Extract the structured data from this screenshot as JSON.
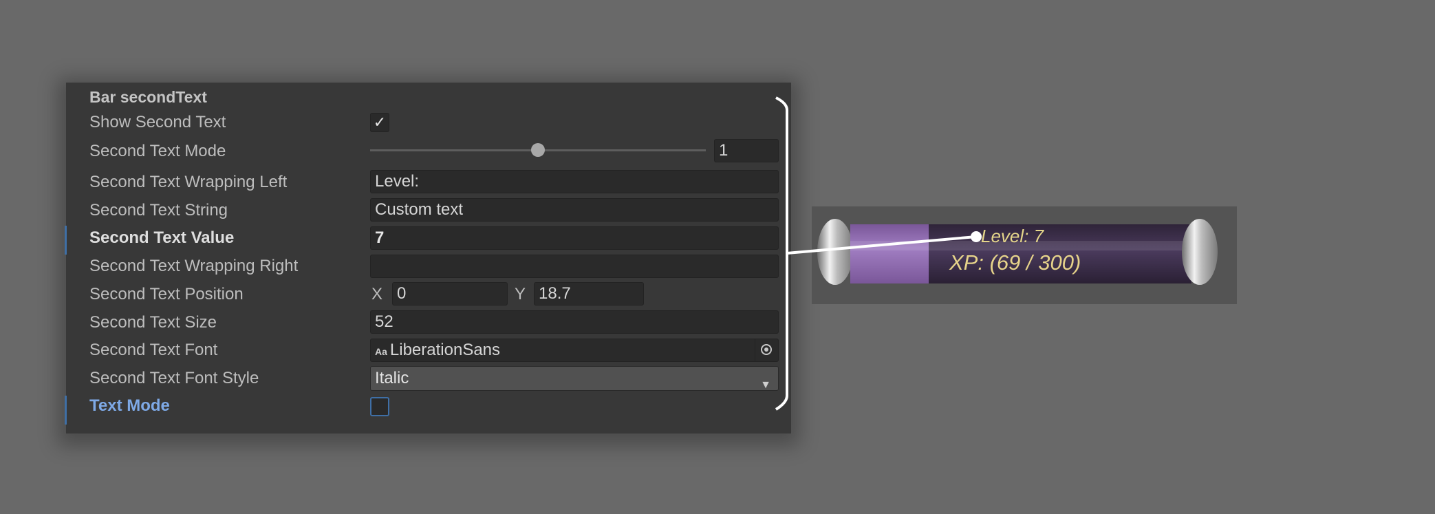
{
  "inspector": {
    "section_title": "Bar secondText",
    "rows": {
      "show_second_text": {
        "label": "Show Second Text",
        "checked": true,
        "check_glyph": "✓"
      },
      "second_text_mode": {
        "label": "Second Text Mode",
        "value": "1",
        "slider_fraction": 0.5
      },
      "wrapping_left": {
        "label": "Second Text Wrapping Left",
        "value": "Level:"
      },
      "text_string": {
        "label": "Second Text String",
        "value": "Custom text"
      },
      "text_value": {
        "label": "Second Text Value",
        "value": "7"
      },
      "wrapping_right": {
        "label": "Second Text Wrapping Right",
        "value": ""
      },
      "position": {
        "label": "Second Text Position",
        "x_label": "X",
        "x_value": "0",
        "y_label": "Y",
        "y_value": "18.7"
      },
      "size": {
        "label": "Second Text Size",
        "value": "52"
      },
      "font": {
        "label": "Second Text Font",
        "value": "LiberationSans",
        "icon_text": "Aa",
        "icon": "font-asset-icon"
      },
      "font_style": {
        "label": "Second Text Font Style",
        "value": "Italic",
        "icon": "dropdown-caret-icon"
      },
      "text_mode": {
        "label": "Text Mode",
        "checked": false
      }
    }
  },
  "preview": {
    "level_text": "Level: 7",
    "xp_text": "XP: (69 / 300)",
    "fill_fraction": 0.23
  },
  "colors": {
    "background": "#696969",
    "panel": "#383838",
    "accent_blue": "#7ea9e6",
    "preview_text": "#e5d68a",
    "bar_fill": "#8f6cb1",
    "bar_empty": "#3a2d48"
  }
}
